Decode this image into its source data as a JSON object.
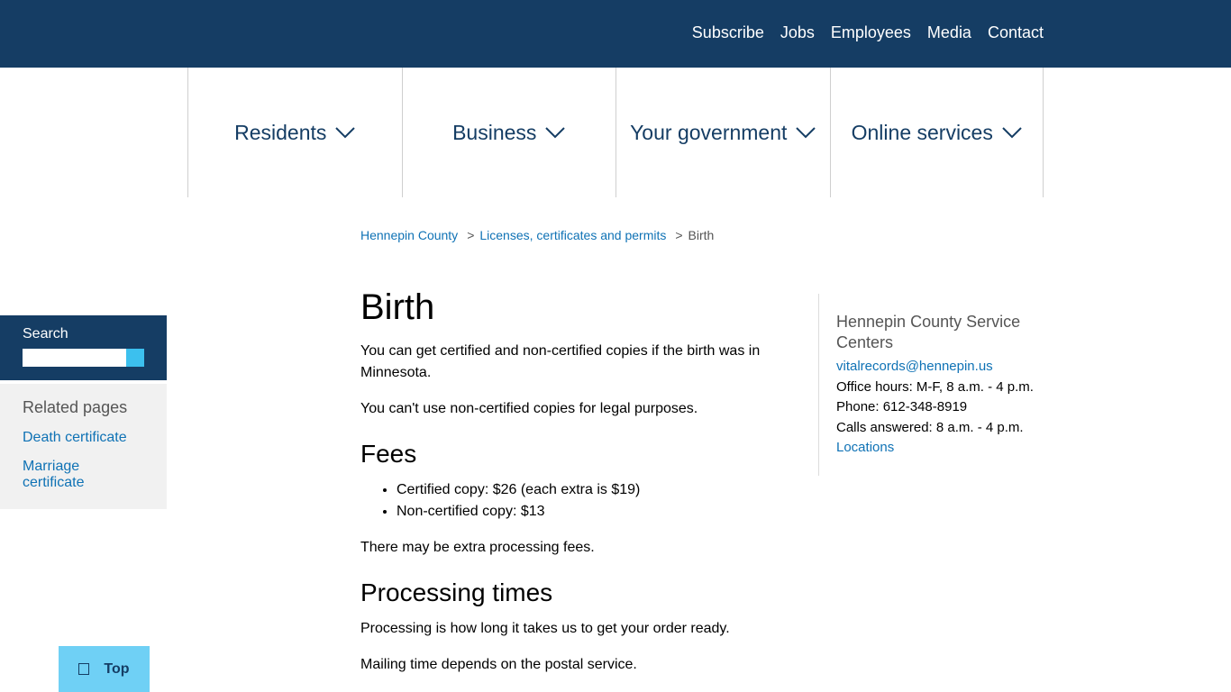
{
  "utility_nav": [
    "Subscribe",
    "Jobs",
    "Employees",
    "Media",
    "Contact"
  ],
  "main_nav": [
    "Residents",
    "Business",
    "Your government",
    "Online services"
  ],
  "breadcrumb": {
    "items": [
      "Hennepin County",
      "Licenses, certificates and permits"
    ],
    "separator": ">",
    "current": "Birth"
  },
  "search": {
    "label": "Search",
    "placeholder": ""
  },
  "related": {
    "title": "Related pages",
    "links": [
      "Death certificate",
      "Marriage certificate"
    ]
  },
  "main": {
    "title": "Birth",
    "intro1": "You can get certified and non-certified copies if the birth was in Minnesota.",
    "intro2": "You can't use non-certified copies for legal purposes.",
    "fees_heading": "Fees",
    "fees": [
      "Certified copy: $26 (each extra is $19)",
      "Non-certified copy: $13"
    ],
    "fees_note": "There may be extra processing fees.",
    "processing_heading": "Processing times",
    "processing1": "Processing is how long it takes us to get your order ready.",
    "processing2": "Mailing time depends on the postal service."
  },
  "aside": {
    "title": "Hennepin County Service Centers",
    "email": "vitalrecords@hennepin.us",
    "hours": "Office hours: M-F, 8 a.m. - 4 p.m.",
    "phone": "Phone: 612-348-8919",
    "calls": "Calls answered: 8 a.m. - 4 p.m.",
    "locations": "Locations"
  },
  "top_button": "Top",
  "colors": {
    "brand": "#153d64",
    "link": "#0f72b5",
    "accent": "#3cc0ee",
    "top_button": "#6fd0f5"
  },
  "icons": {
    "nav_chevron": "chevron-down-icon",
    "top": "arrow-up-icon"
  }
}
